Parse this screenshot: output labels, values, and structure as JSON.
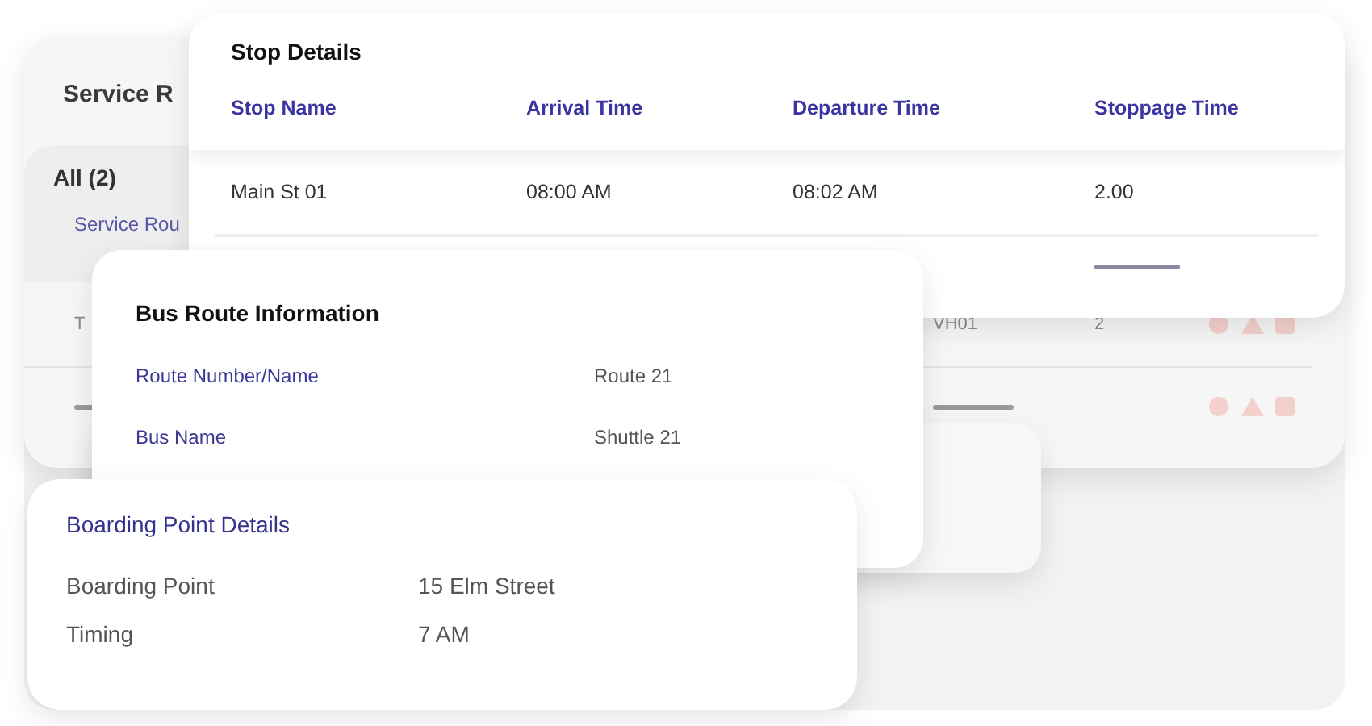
{
  "service_routes": {
    "title": "Service R",
    "filter_tab": {
      "label": "All (2)",
      "selected": true
    },
    "column_1": "Service Rou",
    "rows": [
      {
        "kind": "data",
        "cells": [
          "T",
          "VH01",
          "2"
        ]
      },
      {
        "kind": "placeholder",
        "cells": [
          {
            "kind": "bar"
          },
          {
            "kind": "bar"
          },
          {
            "kind": "empty"
          }
        ]
      }
    ]
  },
  "stop_details": {
    "title": "Stop Details",
    "columns": [
      "Stop Name",
      "Arrival Time",
      "Departure Time",
      "Stoppage Time"
    ],
    "rows": [
      {
        "kind": "data",
        "cells": [
          "Main St 01",
          "08:00 AM",
          "08:02 AM",
          "2.00"
        ]
      },
      {
        "kind": "placeholder",
        "cells": [
          {
            "kind": "empty"
          },
          {
            "kind": "empty"
          },
          {
            "kind": "empty"
          },
          {
            "kind": "bar"
          }
        ]
      }
    ]
  },
  "bus_route": {
    "title": "Bus Route Information",
    "fields": [
      {
        "label": "Route Number/Name",
        "value": "Route 21"
      },
      {
        "label": "Bus Name",
        "value": "Shuttle 21"
      }
    ]
  },
  "boarding_point": {
    "title": "Boarding Point Details",
    "fields": [
      {
        "label": "Boarding Point",
        "value": "15 Elm Street"
      },
      {
        "label": "Timing",
        "value": "7 AM"
      }
    ]
  }
}
